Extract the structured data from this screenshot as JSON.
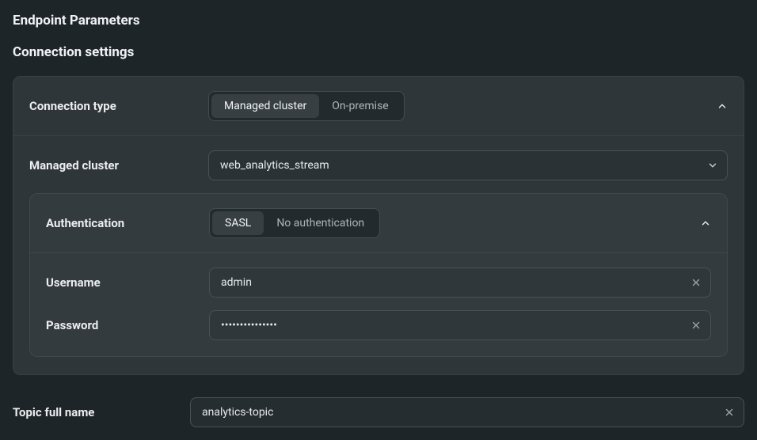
{
  "page": {
    "title": "Endpoint Parameters",
    "section_title": "Connection settings"
  },
  "connection_type": {
    "label": "Connection type",
    "options": {
      "managed": "Managed cluster",
      "on_premise": "On-premise"
    },
    "active": "managed"
  },
  "managed_cluster": {
    "label": "Managed cluster",
    "value": "web_analytics_stream"
  },
  "authentication": {
    "label": "Authentication",
    "options": {
      "sasl": "SASL",
      "none": "No authentication"
    },
    "active": "sasl",
    "username_label": "Username",
    "username_value": "admin",
    "password_label": "Password",
    "password_value": "•••••••••••••••"
  },
  "topic": {
    "label": "Topic full name",
    "value": "analytics-topic"
  }
}
